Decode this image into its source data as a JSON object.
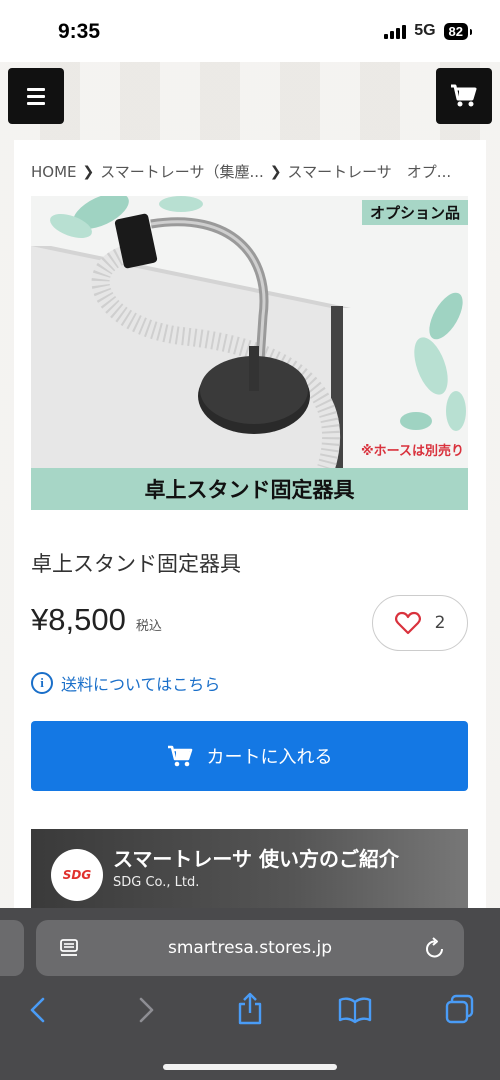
{
  "status_bar": {
    "time": "9:35",
    "network": "5G",
    "battery": "82",
    "icons": [
      "signal-icon",
      "battery-icon"
    ]
  },
  "header": {
    "menu_icon": "hamburger-icon",
    "cart_icon": "cart-icon"
  },
  "breadcrumb": {
    "items": [
      "HOME",
      "スマートレーサ（集塵...",
      "スマートレーサ　オプ..."
    ]
  },
  "product": {
    "image_badge": "オプション品",
    "image_note": "※ホースは別売り",
    "image_banner": "卓上スタンド固定器具",
    "title": "卓上スタンド固定器具",
    "price": "¥8,500",
    "tax_label": "税込",
    "favorite_count": "2",
    "shipping_link": "送料についてはこちら",
    "add_to_cart": "カートに入れる"
  },
  "video": {
    "logo_text": "SDG",
    "title": "スマートレーサ 使い方のご紹介",
    "channel": "SDG Co., Ltd."
  },
  "browser": {
    "url": "smartresa.stores.jp"
  },
  "colors": {
    "accent_blue": "#1478e4",
    "mint": "#a7d6c6",
    "note_red": "#d9323d"
  }
}
